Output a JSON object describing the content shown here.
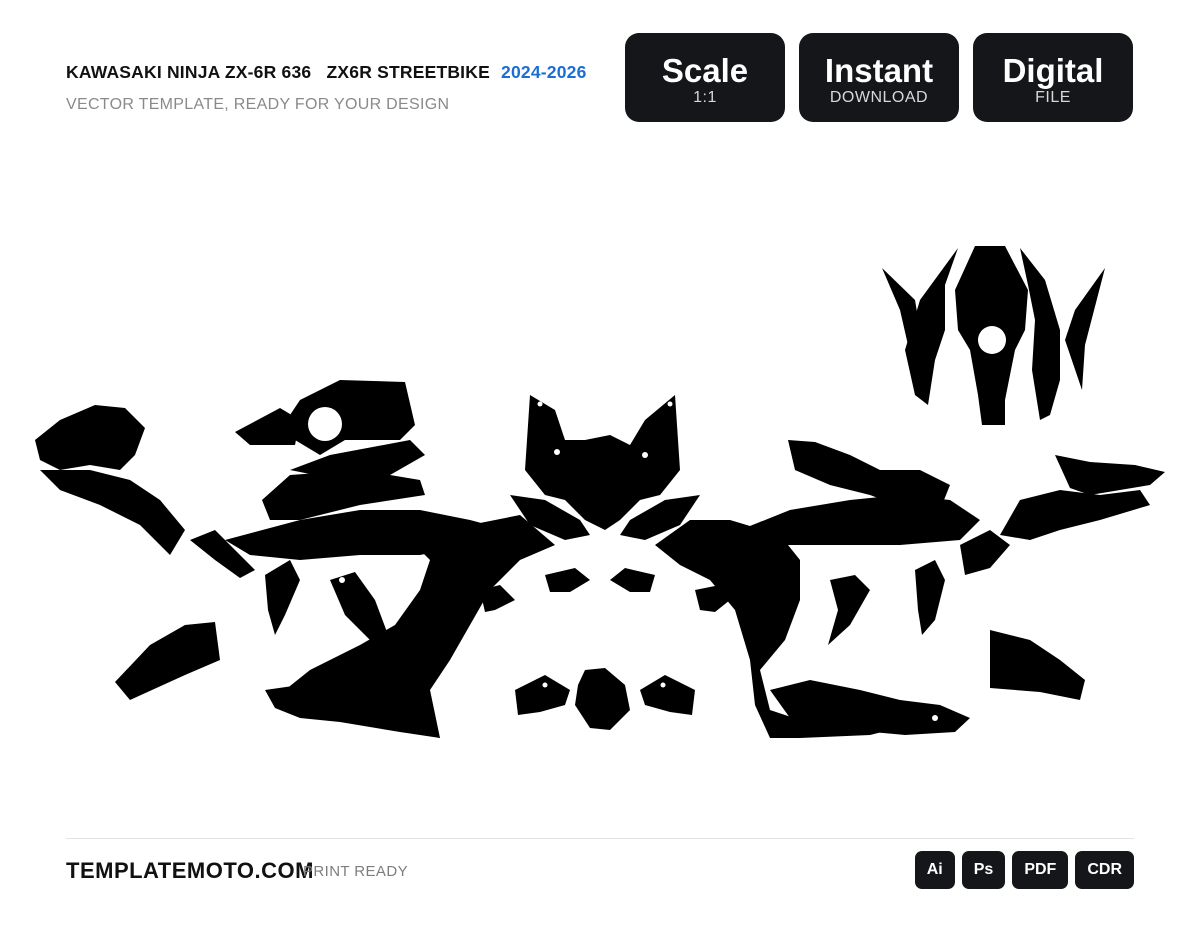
{
  "header": {
    "model": "KAWASAKI NINJA ZX-6R 636   ZX6R STREETBIKE",
    "years": "2024-2026",
    "subtitle": "VECTOR TEMPLATE, READY FOR YOUR DESIGN"
  },
  "badges": [
    {
      "title": "Scale",
      "caption": "1:1"
    },
    {
      "title": "Instant",
      "caption": "DOWNLOAD"
    },
    {
      "title": "Digital",
      "caption": "FILE"
    }
  ],
  "footer": {
    "brand": "TEMPLATEMOTO.COM",
    "tag": "PRINT READY",
    "formats": [
      "Ai",
      "Ps",
      "PDF",
      "CDR"
    ]
  },
  "colors": {
    "accent": "#1a6fd6",
    "badge_bg": "#15161a",
    "template_fill": "#000000"
  }
}
